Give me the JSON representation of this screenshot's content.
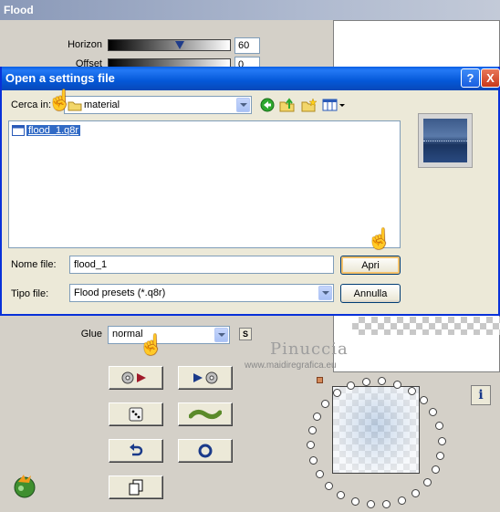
{
  "flood": {
    "title": "Flood",
    "horizon_label": "Horizon",
    "horizon_value": "60",
    "offset_label": "Offset",
    "offset_value": "0",
    "glue_label": "Glue",
    "glue_value": "normal",
    "glue_small_button": "S"
  },
  "dialog": {
    "title": "Open a settings file",
    "help_label": "?",
    "close_label": "X",
    "look_in_label": "Cerca in:",
    "look_in_value": "material",
    "file_items": [
      {
        "name": "flood_1.q8r"
      }
    ],
    "filename_label": "Nome file:",
    "filename_value": "flood_1",
    "filetype_label": "Tipo file:",
    "filetype_value": "Flood presets (*.q8r)",
    "open_button": "Apri",
    "cancel_button": "Annulla"
  },
  "watermark": {
    "title": "Pinuccia",
    "url": "www.maidiregrafica.eu"
  },
  "info_button": "i",
  "colors": {
    "titlebar_xp": "#0458d8",
    "dialog_bg": "#ece9d8",
    "plugin_bg": "#d4d0c8",
    "selection": "#316ac5"
  }
}
